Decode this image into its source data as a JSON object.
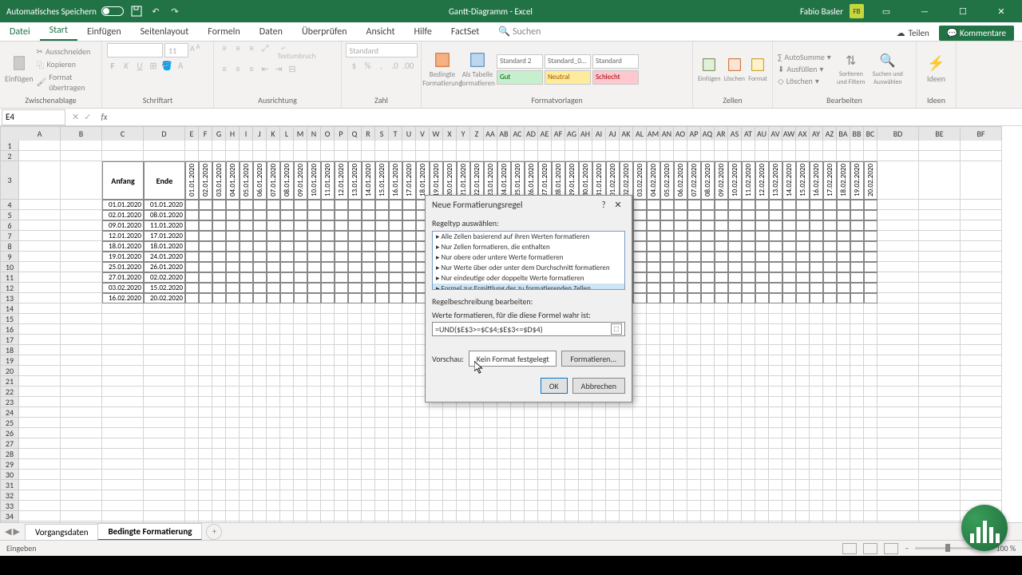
{
  "title_bar": {
    "autosave": "Automatisches Speichern",
    "doc_title": "Gantt-Diagramm - Excel",
    "user_name": "Fabio Basler",
    "user_initials": "FB"
  },
  "tabs": {
    "file": "Datei",
    "home": "Start",
    "insert": "Einfügen",
    "pagelayout": "Seitenlayout",
    "formulas": "Formeln",
    "data": "Daten",
    "review": "Überprüfen",
    "view": "Ansicht",
    "help": "Hilfe",
    "factset": "FactSet",
    "search_ph": "Suchen",
    "share": "Teilen",
    "comments": "Kommentare"
  },
  "ribbon": {
    "clipboard": {
      "paste": "Einfügen",
      "cut": "Ausschneiden",
      "copy": "Kopieren",
      "painter": "Format übertragen",
      "label": "Zwischenablage"
    },
    "font": {
      "size": "11",
      "label": "Schriftart"
    },
    "align": {
      "wrap": "Textumbruch",
      "merge": "",
      "label": "Ausrichtung"
    },
    "number": {
      "format": "Standard",
      "label": "Zahl"
    },
    "styles": {
      "cond": "Bedingte Formatierung",
      "astable": "Als Tabelle formatieren",
      "s1": "Standard 2",
      "s2": "Standard_0…",
      "s3": "Standard",
      "s4": "Gut",
      "s5": "Neutral",
      "s6": "Schlecht",
      "label": "Formatvorlagen"
    },
    "cells": {
      "insert": "Einfügen",
      "delete": "Löschen",
      "format": "Format",
      "label": "Zellen"
    },
    "editing": {
      "sum": "AutoSumme",
      "fill": "Ausfüllen",
      "clear": "Löschen",
      "sort": "Sortieren und Filtern",
      "find": "Suchen und Auswählen",
      "label": "Bearbeiten"
    },
    "ideas": {
      "ideas": "Ideen",
      "label": "Ideen"
    }
  },
  "namebox": "E4",
  "col_headers_wide": [
    "A",
    "B",
    "C",
    "D"
  ],
  "col_headers_narrow": [
    "E",
    "F",
    "G",
    "H",
    "I",
    "J",
    "K",
    "L",
    "M",
    "N",
    "O",
    "P",
    "Q",
    "R",
    "S",
    "T",
    "U",
    "V",
    "W",
    "X",
    "Y",
    "Z",
    "AA",
    "AB",
    "AC",
    "AD",
    "AE",
    "AF",
    "AG",
    "AH",
    "AI",
    "AJ",
    "AK",
    "AL",
    "AM",
    "AN",
    "AO",
    "AP",
    "AQ",
    "AR",
    "AS",
    "AT",
    "AU",
    "AV",
    "AW",
    "AX",
    "AY",
    "AZ",
    "BA",
    "BB",
    "BC"
  ],
  "col_headers_tail": [
    "BD",
    "BE",
    "BF"
  ],
  "table": {
    "h_anfang": "Anfang",
    "h_ende": "Ende",
    "dates_row": [
      "01.01.2020",
      "02.01.2020",
      "03.01.2020",
      "04.01.2020",
      "05.01.2020",
      "06.01.2020",
      "07.01.2020",
      "08.01.2020",
      "09.01.2020",
      "10.01.2020",
      "11.01.2020",
      "12.01.2020",
      "13.01.2020",
      "14.01.2020",
      "15.01.2020",
      "16.01.2020",
      "17.01.2020",
      "18.01.2020",
      "19.01.2020",
      "20.01.2020",
      "21.01.2020",
      "22.01.2020",
      "23.01.2020",
      "24.01.2020",
      "25.01.2020",
      "26.01.2020",
      "27.01.2020",
      "28.01.2020",
      "29.01.2020",
      "30.01.2020",
      "31.01.2020",
      "01.02.2020",
      "02.02.2020",
      "03.02.2020",
      "04.02.2020",
      "05.02.2020",
      "06.02.2020",
      "07.02.2020",
      "08.02.2020",
      "09.02.2020",
      "10.02.2020",
      "11.02.2020",
      "12.02.2020",
      "13.02.2020",
      "14.02.2020",
      "15.02.2020",
      "16.02.2020",
      "17.02.2020",
      "18.02.2020",
      "19.02.2020",
      "20.02.2020"
    ],
    "rows": [
      {
        "anfang": "01.01.2020",
        "ende": "01.01.2020"
      },
      {
        "anfang": "02.01.2020",
        "ende": "08.01.2020"
      },
      {
        "anfang": "09.01.2020",
        "ende": "11.01.2020"
      },
      {
        "anfang": "12.01.2020",
        "ende": "17.01.2020"
      },
      {
        "anfang": "18.01.2020",
        "ende": "18.01.2020"
      },
      {
        "anfang": "19.01.2020",
        "ende": "24.01.2020"
      },
      {
        "anfang": "25.01.2020",
        "ende": "26.01.2020"
      },
      {
        "anfang": "27.01.2020",
        "ende": "02.02.2020"
      },
      {
        "anfang": "03.02.2020",
        "ende": "15.02.2020"
      },
      {
        "anfang": "16.02.2020",
        "ende": "20.02.2020"
      }
    ]
  },
  "dialog": {
    "title": "Neue Formatierungsregel",
    "type_label": "Regeltyp auswählen:",
    "types": [
      "Alle Zellen basierend auf ihren Werten formatieren",
      "Nur Zellen formatieren, die enthalten",
      "Nur obere oder untere Werte formatieren",
      "Nur Werte über oder unter dem Durchschnitt formatieren",
      "Nur eindeutige oder doppelte Werte formatieren",
      "Formel zur Ermittlung der zu formatierenden Zellen verwenden"
    ],
    "desc_label": "Regelbeschreibung bearbeiten:",
    "formula_label": "Werte formatieren, für die diese Formel wahr ist:",
    "formula": "=UND($E$3>=$C$4;$E$3<=$D$4)",
    "preview_label": "Vorschau:",
    "preview_text": "Kein Format festgelegt",
    "format_btn": "Formatieren...",
    "ok": "OK",
    "cancel": "Abbrechen"
  },
  "sheets": {
    "s1": "Vorgangsdaten",
    "s2": "Bedingte Formatierung"
  },
  "status": {
    "mode": "Eingeben",
    "zoom": "100 %"
  }
}
